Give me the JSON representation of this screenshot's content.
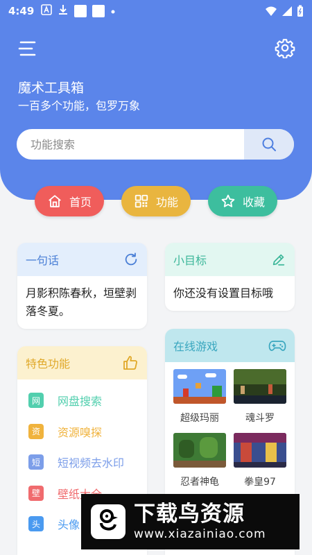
{
  "status": {
    "time": "4:49"
  },
  "header": {
    "title": "魔术工具箱",
    "subtitle": "一百多个功能，包罗万象",
    "bg_color": "#5b85ea"
  },
  "search": {
    "placeholder": "功能搜索",
    "icon": "search-icon"
  },
  "nav": [
    {
      "label": "首页",
      "icon": "home-icon",
      "color": "#f05d5b"
    },
    {
      "label": "功能",
      "icon": "apps-icon",
      "color": "#e9b53f"
    },
    {
      "label": "收藏",
      "icon": "star-icon",
      "color": "#3dbe9e"
    }
  ],
  "quote_card": {
    "title": "一句话",
    "icon": "refresh-icon",
    "text": "月影积陈春秋，垣壁剥落冬夏。",
    "head_color": "#e3eefc",
    "accent": "#4a7fd6"
  },
  "goal_card": {
    "title": "小目标",
    "icon": "edit-icon",
    "text": "你还没有设置目标哦",
    "head_color": "#e2f7f1",
    "accent": "#3db79a"
  },
  "features_card": {
    "title": "特色功能",
    "icon": "thumbs-up-icon",
    "head_color": "#fcf1cf",
    "accent": "#e0a828",
    "items": [
      {
        "badge": "网",
        "label": "网盘搜索",
        "color": "#52cfae"
      },
      {
        "badge": "资",
        "label": "资源嗅探",
        "color": "#f0b33d"
      },
      {
        "badge": "短",
        "label": "短视频去水印",
        "color": "#7c9ee9"
      },
      {
        "badge": "壁",
        "label": "壁纸大全",
        "color": "#f06b6e"
      },
      {
        "badge": "头",
        "label": "头像",
        "color": "#4a9af0"
      }
    ]
  },
  "games_card": {
    "title": "在线游戏",
    "icon": "gamepad-icon",
    "head_color": "#bfe7ee",
    "accent": "#3aa7bf",
    "games": [
      {
        "name": "超级玛丽"
      },
      {
        "name": "魂斗罗"
      },
      {
        "name": "忍者神龟"
      },
      {
        "name": "拳皇97"
      }
    ]
  },
  "watermark": {
    "title": "下载鸟资源",
    "url": "www.xiazainiao.com"
  }
}
